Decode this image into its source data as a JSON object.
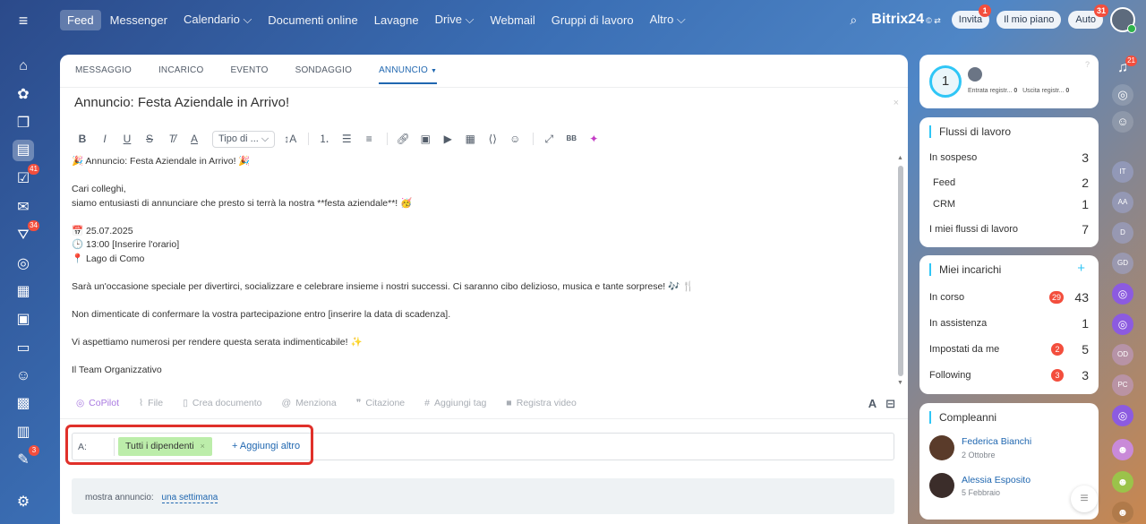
{
  "topbar": {
    "nav": [
      "Feed",
      "Messenger",
      "Calendario ⌵",
      "Documenti online",
      "Lavagne",
      "Drive ⌵",
      "Webmail",
      "Gruppi di lavoro",
      "Altro ⌵"
    ],
    "brand": "Bitrix24",
    "brand_sup": "© ⇄",
    "invite": "Invita",
    "invite_badge": "1",
    "plan": "Il mio piano",
    "auto": "Auto",
    "auto_badge": "31"
  },
  "left_badges": {
    "tasks": "41",
    "feed": "34",
    "approvals": "3"
  },
  "tabs": [
    "MESSAGGIO",
    "INCARICO",
    "EVENTO",
    "SONDAGGIO",
    "ANNUNCIO"
  ],
  "editor": {
    "title": "Annuncio: Festa Aziendale in Arrivo!",
    "font_select": "Tipo di ...",
    "lines": [
      "🎉 Annuncio: Festa Aziendale in Arrivo! 🎉",
      "",
      "Cari colleghi,",
      "siamo entusiasti di annunciare che presto si terrà la nostra **festa aziendale**! 🥳",
      "",
      "📅 25.07.2025",
      "🕒 13:00 [Inserire l'orario]",
      "📍 Lago di Como",
      "",
      "Sarà un'occasione speciale per divertirci, socializzare e celebrare insieme i nostri successi. Ci saranno cibo delizioso, musica e tante sorprese! 🎶 🍴",
      "",
      "Non dimenticate di confermare la vostra partecipazione entro [inserire la data di scadenza].",
      "",
      "Vi aspettiamo numerosi per rendere questa serata indimenticabile! ✨",
      "",
      "Il Team Organizzativo"
    ]
  },
  "bottom_tools": [
    "CoPilot",
    "File",
    "Crea documento",
    "Menziona",
    "Citazione",
    "Aggiungi tag",
    "Registra video"
  ],
  "recipients": {
    "label": "A:",
    "chip": "Tutti i dipendenti",
    "add": "+ Aggiungi altro"
  },
  "show": {
    "label": "mostra annuncio:",
    "value": "una settimana"
  },
  "timeman": {
    "count": "1",
    "checkin": "Entrata registr...",
    "checkin_v": "0",
    "checkout": "Uscita registr...",
    "checkout_v": "0"
  },
  "workflows": {
    "title": "Flussi di lavoro",
    "rows": [
      {
        "label": "In sospeso",
        "v": "3"
      },
      {
        "label": "Feed",
        "v": "2"
      },
      {
        "label": "CRM",
        "v": "1"
      },
      {
        "label": "I miei flussi di lavoro",
        "v": "7"
      }
    ]
  },
  "tasks": {
    "title": "Miei incarichi",
    "plus": "+",
    "rows": [
      {
        "label": "In corso",
        "b": "29",
        "v": "43"
      },
      {
        "label": "In assistenza",
        "b": "",
        "v": "1"
      },
      {
        "label": "Impostati da me",
        "b": "2",
        "v": "5"
      },
      {
        "label": "Following",
        "b": "3",
        "v": "3"
      }
    ]
  },
  "birthdays": {
    "title": "Compleanni",
    "people": [
      {
        "name": "Federica Bianchi",
        "date": "2 Ottobre"
      },
      {
        "name": "Alessia Esposito",
        "date": "5 Febbraio"
      }
    ]
  },
  "right_bar": {
    "notif_badge": "21",
    "initials": [
      "IT",
      "AA",
      "D",
      "GD",
      "",
      "",
      "OD",
      "PC",
      "",
      "",
      "",
      ""
    ]
  }
}
